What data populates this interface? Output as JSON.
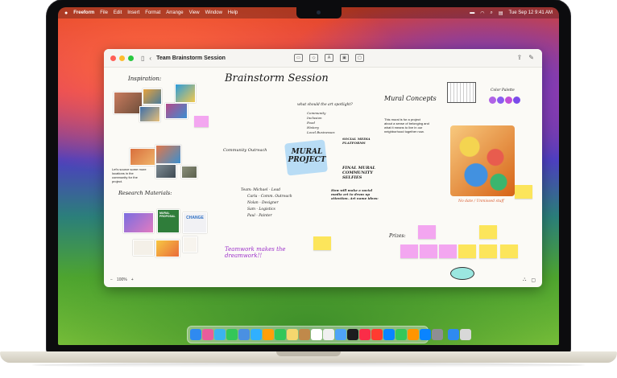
{
  "menubar": {
    "apple": "",
    "items": [
      "Freeform",
      "File",
      "Edit",
      "Insert",
      "Format",
      "Arrange",
      "View",
      "Window",
      "Help"
    ],
    "datetime": "Tue Sep 12  9:41 AM"
  },
  "window": {
    "title": "Team Brainstorm Session",
    "zoom": "100%"
  },
  "board": {
    "inspiration_heading": "Inspiration:",
    "brainstorm_heading": "Brainstorm Session",
    "mural_concepts_heading": "Mural Concepts",
    "color_palette_label": "Color Palette",
    "research_heading": "Research Materials:",
    "project_description": "This mural is for a project about a sense of belonging and what it means to live in our neighborhood together now.",
    "location_note": "Let's source some more locations in the community for the project.",
    "mural_project_title": "MURAL PROJECT",
    "what_spotlight": "what should the art spotlight?",
    "spotlight_items": [
      "Community",
      "Inclusion",
      "Food",
      "History",
      "Local Businesses"
    ],
    "social_media": "SOCIAL MEDIA PLATFORMS",
    "final_mural": "FINAL MURAL COMMUNITY SELFIES",
    "team_list": [
      "Team: Michael - Lead",
      "Carla - Comm. Outreach",
      "Nolan - Designer",
      "Sam - Logistics",
      "Paul - Painter"
    ],
    "community_outreach": "Community Outreach",
    "teamwork_note": "Teamwork makes the dreamwork!!",
    "prizes_heading": "Prizes:",
    "research_cards": [
      "MURAL PROPOSAL",
      "CHANGE"
    ],
    "date_note": "No date / Unmissed stuff",
    "mural_note": "How will make a social media art to drum up attention. Art name ideas:"
  },
  "colors": {
    "palette": [
      "#b063e6",
      "#8a5cf0",
      "#c24fd8",
      "#7a4bea"
    ],
    "sticky_yellow": "#fce55b",
    "sticky_pink": "#f3a6f0"
  }
}
